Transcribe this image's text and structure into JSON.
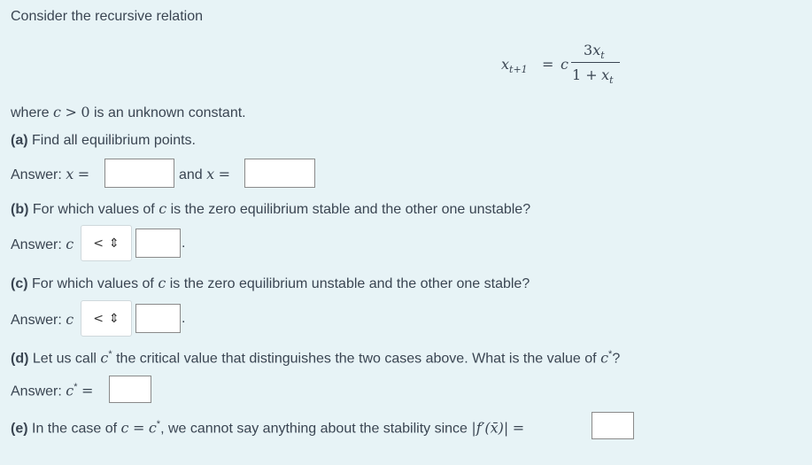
{
  "intro": "Consider the recursive relation",
  "equation": {
    "lhs": "x",
    "lhs_sub": "t+1",
    "equals": "=",
    "coef": "c",
    "num_3": "3",
    "num_x": "x",
    "num_sub": "t",
    "den_1": "1 +",
    "den_x": "x",
    "den_sub": "t"
  },
  "where": {
    "prefix": "where",
    "c": "c",
    "gt": ">",
    "zero": "0",
    "suffix": "is an unknown constant."
  },
  "part_a": {
    "label": "(a)",
    "text": "Find all equilibrium points.",
    "answer_label": "Answer:",
    "var": "x",
    "eq": "=",
    "and_text": "and",
    "var2": "x",
    "eq2": "=",
    "input1_value": "",
    "input2_value": ""
  },
  "part_b": {
    "label": "(b)",
    "text_pre": "For which values of",
    "c": "c",
    "text_post": "is the zero equilibrium stable and the other one unstable?",
    "answer_label": "Answer:",
    "var": "c",
    "select_value": "<",
    "select_arrow": "⇕",
    "input_value": "",
    "period": "."
  },
  "part_c": {
    "label": "(c)",
    "text_pre": "For which values of",
    "c": "c",
    "text_post": "is the zero equilibrium unstable and the other one stable?",
    "answer_label": "Answer:",
    "var": "c",
    "select_value": "<",
    "select_arrow": "⇕",
    "input_value": "",
    "period": "."
  },
  "part_d": {
    "label": "(d)",
    "text_pre": "Let us call",
    "cstar": "c",
    "star": "*",
    "text_post": "the critical value that distinguishes the two cases above. What is the value of",
    "cstar2": "c",
    "star2": "*",
    "qmark": "?",
    "answer_label": "Answer:",
    "var": "c",
    "var_star": "*",
    "eq": "=",
    "input_value": ""
  },
  "part_e": {
    "label": "(e)",
    "text_pre": "In the case of",
    "c": "c",
    "eq": "=",
    "cstar": "c",
    "star": "*",
    "text_post": ", we cannot say anything about the stability since",
    "abs_expr": "|f′(x̄)|",
    "eq2": "=",
    "input_value": ""
  }
}
